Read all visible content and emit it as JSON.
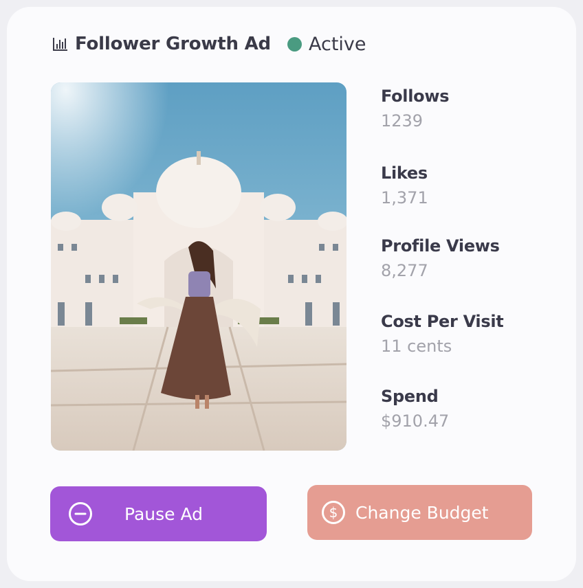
{
  "ad": {
    "title": "Follower Growth Ad",
    "status": "Active",
    "status_color": "#4a9b81"
  },
  "image": {
    "subject": "woman in flowing skirt in front of white domed palace",
    "icon": "ad-photo"
  },
  "stats": [
    {
      "label": "Follows",
      "value": "1239"
    },
    {
      "label": "Likes",
      "value": "1,371"
    },
    {
      "label": "Profile Views",
      "value": "8,277"
    },
    {
      "label": "Cost Per Visit",
      "value": "11 cents"
    },
    {
      "label": "Spend",
      "value": "$910.47"
    }
  ],
  "buttons": {
    "pause_label": "Pause Ad",
    "pause_icon": "minus-circle-icon",
    "pause_color": "#a256d8",
    "budget_label": "Change Budget",
    "budget_icon": "dollar-circle-icon",
    "budget_color": "#e59d92"
  }
}
